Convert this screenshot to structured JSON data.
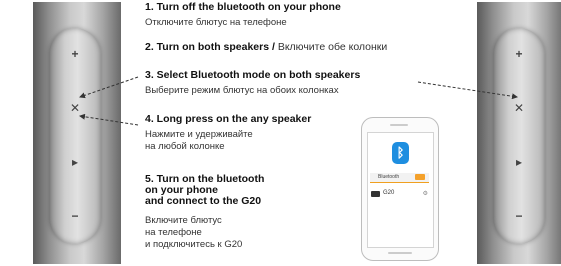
{
  "steps": [
    {
      "title": "1. Turn off the bluetooth on your phone",
      "sub": "Отключите блютус на телефоне"
    },
    {
      "title": "2. Turn on both speakers /",
      "title_inline_sub": "Включите обе колонки"
    },
    {
      "title": "3. Select Bluetooth mode on both speakers",
      "sub": "Выберите режим блютус на обоих колонках"
    },
    {
      "title": "4. Long press on the any speaker",
      "sub_lines": [
        "Нажмите и удерживайте",
        "на любой колонке"
      ]
    },
    {
      "title_lines": [
        "5. Turn on the bluetooth",
        "on your phone",
        "and connect to the G20"
      ],
      "sub_lines": [
        "Включите блютус",
        "на телефоне",
        "и подключитесь к G20"
      ]
    }
  ],
  "phone": {
    "bar_label": "Bluetooth",
    "device_name": "G20"
  },
  "colors": {
    "bluetooth_blue": "#1e8ee0",
    "toggle_orange": "#f4a12b"
  }
}
